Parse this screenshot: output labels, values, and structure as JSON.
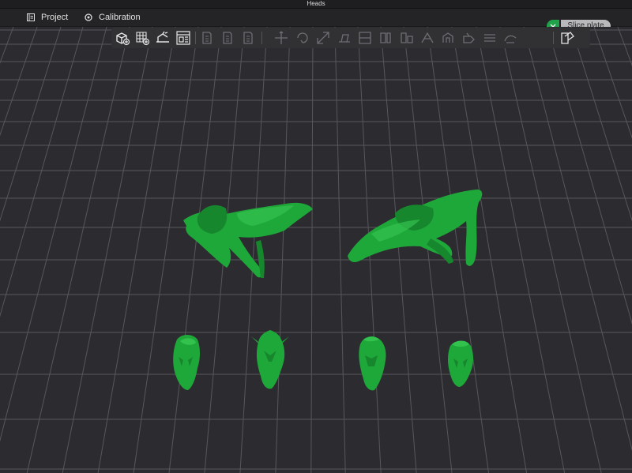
{
  "window": {
    "title": "Heads"
  },
  "menu": {
    "project_label": "Project",
    "calibration_label": "Calibration"
  },
  "slice": {
    "button_label": "Slice plate"
  },
  "colors": {
    "accent": "#1fa24a",
    "model_green": "#1fa83a",
    "viewport_bg": "#2c2c30",
    "grid": "#56565c"
  },
  "toolbar": {
    "tools": [
      "add-object-icon",
      "add-plate-icon",
      "auto-orient-icon",
      "arrange-icon",
      "copy-icon",
      "paste-icon",
      "delete-icon",
      "move-icon",
      "rotate-icon",
      "scale-icon",
      "lay-on-face-icon",
      "cut-icon",
      "split-objects-icon",
      "split-parts-icon",
      "variable-height-icon",
      "support-paint-icon",
      "seam-paint-icon",
      "color-paint-icon",
      "measure-icon",
      "assembly-view-icon"
    ]
  }
}
